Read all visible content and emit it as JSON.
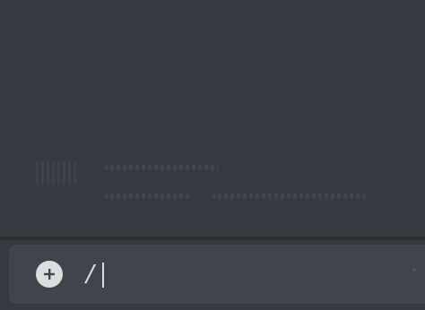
{
  "chat": {
    "background_color": "#36393f"
  },
  "composer": {
    "background_color": "#40444b",
    "add_icon": "plus-circle-icon",
    "input_value": "/",
    "input_placeholder": ""
  }
}
